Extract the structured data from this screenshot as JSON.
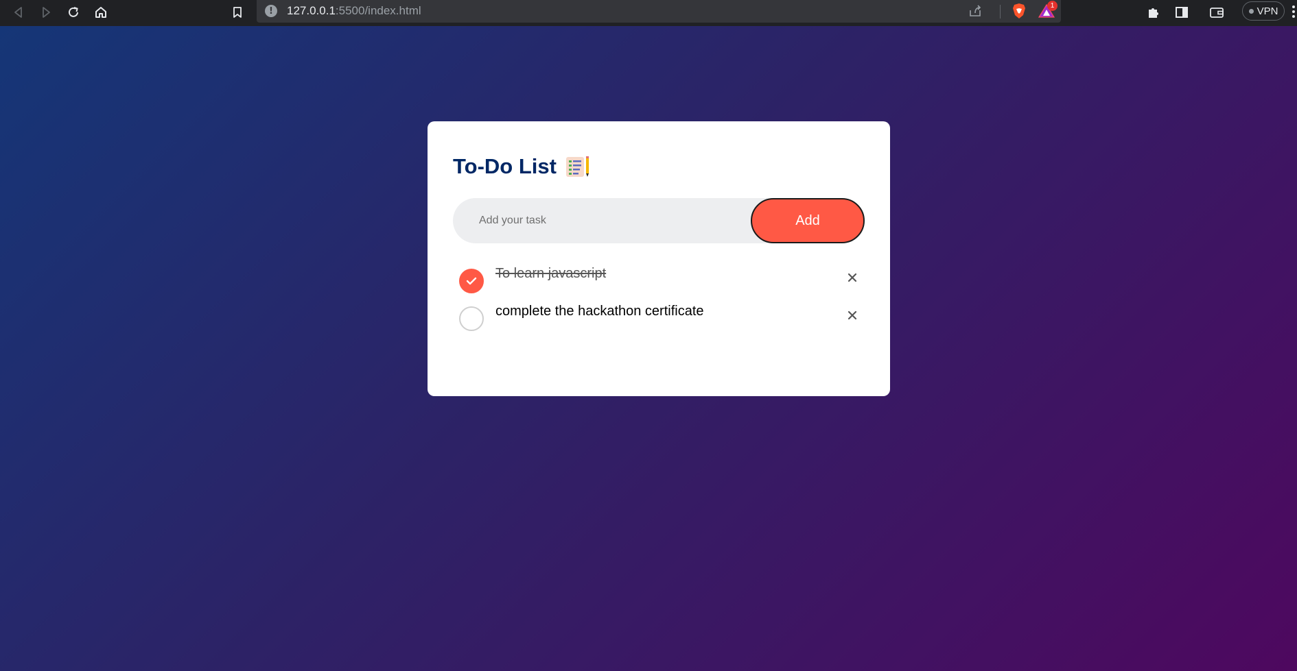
{
  "browser": {
    "url_host": "127.0.0.1",
    "url_path": ":5500/index.html",
    "rewards_badge": "1",
    "vpn_label": "VPN"
  },
  "todo": {
    "title": "To-Do List",
    "input": {
      "value": "",
      "placeholder": "Add your task"
    },
    "add_label": "Add",
    "tasks": [
      {
        "text": "To learn javascript",
        "checked": true
      },
      {
        "text": "complete the hackathon certificate",
        "checked": false
      }
    ]
  },
  "colors": {
    "accent": "#ff5945",
    "title": "#002765",
    "input_bg": "#edeef0",
    "background_start": "#153677",
    "background_end": "#4e085f"
  },
  "icons": {
    "title": "notepad-pencil-icon",
    "checked": "check-icon",
    "delete": "close-icon"
  }
}
